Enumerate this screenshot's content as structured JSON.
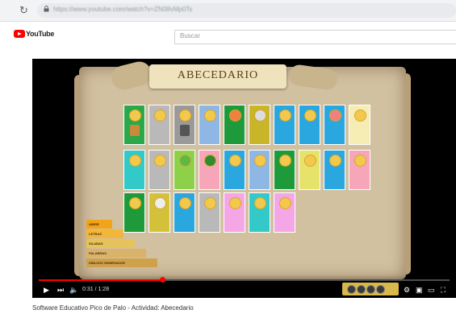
{
  "browser": {
    "url": "https://www.youtube.com/watch?v=ZN08vMp0Ts"
  },
  "youtube": {
    "logo_text": "YouTube",
    "search_placeholder": "Buscar"
  },
  "game": {
    "title": "ABECEDARIO",
    "tiles": [
      {
        "color": "#2aa84a",
        "dot": "#f2c94c",
        "pic": "#c98a3a"
      },
      {
        "color": "#b9b9b9",
        "dot": "#f2c94c",
        "pic": ""
      },
      {
        "color": "#9a9a9a",
        "dot": "#f2c94c",
        "pic": "#555555"
      },
      {
        "color": "#8fb7e6",
        "dot": "#f2c94c",
        "pic": ""
      },
      {
        "color": "#1f9a3a",
        "dot": "#f08040",
        "pic": ""
      },
      {
        "color": "#c8b52a",
        "dot": "#dddddd",
        "pic": ""
      },
      {
        "color": "#2ba7e0",
        "dot": "#f2c94c",
        "pic": ""
      },
      {
        "color": "#2ba7e0",
        "dot": "#f2c94c",
        "pic": ""
      },
      {
        "color": "#2ba7e0",
        "dot": "#f08080",
        "pic": ""
      },
      {
        "color": "#f5edb3",
        "dot": "#f2c94c",
        "pic": ""
      },
      {
        "color": "#34c9c9",
        "dot": "#f2c94c",
        "pic": ""
      },
      {
        "color": "#b9b9b9",
        "dot": "#f2c94c",
        "pic": ""
      },
      {
        "color": "#8ed04a",
        "dot": "#5fb845",
        "pic": ""
      },
      {
        "color": "#f6a6b8",
        "dot": "#2e8b2e",
        "pic": ""
      },
      {
        "color": "#2ba7e0",
        "dot": "#f2c94c",
        "pic": ""
      },
      {
        "color": "#8fb7e6",
        "dot": "#f2c94c",
        "pic": ""
      },
      {
        "color": "#1f9a3a",
        "dot": "#f2c94c",
        "pic": ""
      },
      {
        "color": "#e6e26a",
        "dot": "#f2c94c",
        "pic": ""
      },
      {
        "color": "#2ba7e0",
        "dot": "#f2c94c",
        "pic": ""
      },
      {
        "color": "#f6a6b8",
        "dot": "#f2c94c",
        "pic": ""
      },
      {
        "color": "#1f9a3a",
        "dot": "#f2c94c",
        "pic": ""
      },
      {
        "color": "#d4c13a",
        "dot": "#eeeeee",
        "pic": ""
      },
      {
        "color": "#2ba7e0",
        "dot": "#f2c94c",
        "pic": ""
      },
      {
        "color": "#b9b9b9",
        "dot": "#f2c94c",
        "pic": ""
      },
      {
        "color": "#f4a6e6",
        "dot": "#f2c94c",
        "pic": ""
      },
      {
        "color": "#34c9c9",
        "dot": "#f2c94c",
        "pic": ""
      },
      {
        "color": "#f4a6e6",
        "dot": "#f2c94c",
        "pic": ""
      }
    ],
    "menu_steps": [
      "ABRIR",
      "LETRAS",
      "SILABAS",
      "PALABRAS",
      "DIBUJOS GENERADOR"
    ],
    "step_colors": [
      "#f2a319",
      "#f2b63a",
      "#e6c35a",
      "#d9b36a",
      "#cfa14a"
    ]
  },
  "player": {
    "progress_percent": 30,
    "time": "0:31 / 1:28"
  },
  "video": {
    "title": "Software Educativo Pico de Palo - Actividad: Abecedario"
  }
}
